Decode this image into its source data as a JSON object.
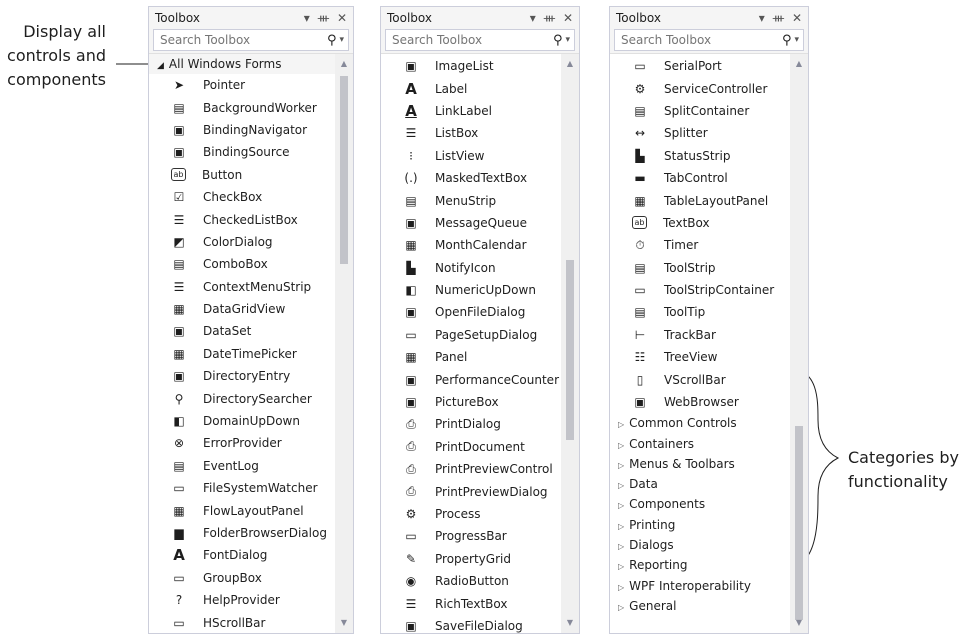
{
  "annotations": {
    "left": "Display all controls and components",
    "right": "Categories by functionality"
  },
  "toolbox1": {
    "title": "Toolbox",
    "search_placeholder": "Search Toolbox",
    "category_header": "All Windows Forms",
    "items": [
      {
        "icon": "pointer-icon",
        "label": "Pointer"
      },
      {
        "icon": "background-worker-icon",
        "label": "BackgroundWorker"
      },
      {
        "icon": "binding-navigator-icon",
        "label": "BindingNavigator"
      },
      {
        "icon": "binding-source-icon",
        "label": "BindingSource"
      },
      {
        "icon": "button-icon",
        "label": "Button"
      },
      {
        "icon": "checkbox-icon",
        "label": "CheckBox"
      },
      {
        "icon": "checked-list-box-icon",
        "label": "CheckedListBox"
      },
      {
        "icon": "color-dialog-icon",
        "label": "ColorDialog"
      },
      {
        "icon": "combobox-icon",
        "label": "ComboBox"
      },
      {
        "icon": "context-menu-strip-icon",
        "label": "ContextMenuStrip"
      },
      {
        "icon": "data-grid-view-icon",
        "label": "DataGridView"
      },
      {
        "icon": "dataset-icon",
        "label": "DataSet"
      },
      {
        "icon": "date-time-picker-icon",
        "label": "DateTimePicker"
      },
      {
        "icon": "directory-entry-icon",
        "label": "DirectoryEntry"
      },
      {
        "icon": "directory-searcher-icon",
        "label": "DirectorySearcher"
      },
      {
        "icon": "domain-up-down-icon",
        "label": "DomainUpDown"
      },
      {
        "icon": "error-provider-icon",
        "label": "ErrorProvider"
      },
      {
        "icon": "event-log-icon",
        "label": "EventLog"
      },
      {
        "icon": "file-system-watcher-icon",
        "label": "FileSystemWatcher"
      },
      {
        "icon": "flow-layout-panel-icon",
        "label": "FlowLayoutPanel"
      },
      {
        "icon": "folder-browser-dialog-icon",
        "label": "FolderBrowserDialog"
      },
      {
        "icon": "font-dialog-icon",
        "label": "FontDialog"
      },
      {
        "icon": "groupbox-icon",
        "label": "GroupBox"
      },
      {
        "icon": "help-provider-icon",
        "label": "HelpProvider"
      },
      {
        "icon": "hscrollbar-icon",
        "label": "HScrollBar"
      }
    ]
  },
  "toolbox2": {
    "title": "Toolbox",
    "search_placeholder": "Search Toolbox",
    "items": [
      {
        "icon": "image-list-icon",
        "label": "ImageList"
      },
      {
        "icon": "label-icon",
        "label": "Label"
      },
      {
        "icon": "link-label-icon",
        "label": "LinkLabel"
      },
      {
        "icon": "listbox-icon",
        "label": "ListBox"
      },
      {
        "icon": "listview-icon",
        "label": "ListView"
      },
      {
        "icon": "masked-textbox-icon",
        "label": "MaskedTextBox"
      },
      {
        "icon": "menu-strip-icon",
        "label": "MenuStrip"
      },
      {
        "icon": "message-queue-icon",
        "label": "MessageQueue"
      },
      {
        "icon": "month-calendar-icon",
        "label": "MonthCalendar"
      },
      {
        "icon": "notify-icon-icon",
        "label": "NotifyIcon"
      },
      {
        "icon": "numeric-up-down-icon",
        "label": "NumericUpDown"
      },
      {
        "icon": "open-file-dialog-icon",
        "label": "OpenFileDialog"
      },
      {
        "icon": "page-setup-dialog-icon",
        "label": "PageSetupDialog"
      },
      {
        "icon": "panel-icon",
        "label": "Panel"
      },
      {
        "icon": "performance-counter-icon",
        "label": "PerformanceCounter"
      },
      {
        "icon": "picturebox-icon",
        "label": "PictureBox"
      },
      {
        "icon": "print-dialog-icon",
        "label": "PrintDialog"
      },
      {
        "icon": "print-document-icon",
        "label": "PrintDocument"
      },
      {
        "icon": "print-preview-control-icon",
        "label": "PrintPreviewControl"
      },
      {
        "icon": "print-preview-dialog-icon",
        "label": "PrintPreviewDialog"
      },
      {
        "icon": "process-icon",
        "label": "Process"
      },
      {
        "icon": "progressbar-icon",
        "label": "ProgressBar"
      },
      {
        "icon": "property-grid-icon",
        "label": "PropertyGrid"
      },
      {
        "icon": "radio-button-icon",
        "label": "RadioButton"
      },
      {
        "icon": "rich-textbox-icon",
        "label": "RichTextBox"
      },
      {
        "icon": "save-file-dialog-icon",
        "label": "SaveFileDialog"
      }
    ]
  },
  "toolbox3": {
    "title": "Toolbox",
    "search_placeholder": "Search Toolbox",
    "items": [
      {
        "icon": "serial-port-icon",
        "label": "SerialPort"
      },
      {
        "icon": "service-controller-icon",
        "label": "ServiceController"
      },
      {
        "icon": "split-container-icon",
        "label": "SplitContainer"
      },
      {
        "icon": "splitter-icon",
        "label": "Splitter"
      },
      {
        "icon": "status-strip-icon",
        "label": "StatusStrip"
      },
      {
        "icon": "tab-control-icon",
        "label": "TabControl"
      },
      {
        "icon": "table-layout-panel-icon",
        "label": "TableLayoutPanel"
      },
      {
        "icon": "textbox-icon",
        "label": "TextBox"
      },
      {
        "icon": "timer-icon",
        "label": "Timer"
      },
      {
        "icon": "toolstrip-icon",
        "label": "ToolStrip"
      },
      {
        "icon": "toolstrip-container-icon",
        "label": "ToolStripContainer"
      },
      {
        "icon": "tooltip-icon",
        "label": "ToolTip"
      },
      {
        "icon": "trackbar-icon",
        "label": "TrackBar"
      },
      {
        "icon": "treeview-icon",
        "label": "TreeView"
      },
      {
        "icon": "vscrollbar-icon",
        "label": "VScrollBar"
      },
      {
        "icon": "web-browser-icon",
        "label": "WebBrowser"
      }
    ],
    "categories": [
      "Common Controls",
      "Containers",
      "Menus & Toolbars",
      "Data",
      "Components",
      "Printing",
      "Dialogs",
      "Reporting",
      "WPF Interoperability",
      "General"
    ]
  },
  "glyphs": {
    "dropdown": "▾",
    "pin": "ᚒ",
    "close": "✕",
    "search": "⚲",
    "collapsed": "▷",
    "expanded": "◢",
    "scroll_up": "▲",
    "scroll_down": "▼"
  }
}
